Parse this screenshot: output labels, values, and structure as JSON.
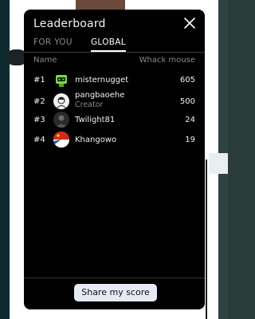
{
  "modal": {
    "title": "Leaderboard",
    "tabs": [
      {
        "label": "FOR YOU",
        "active": false
      },
      {
        "label": "GLOBAL",
        "active": true
      }
    ],
    "columns": {
      "name": "Name",
      "game": "Whack mouse"
    },
    "rows": [
      {
        "rank": "#1",
        "name": "misternugget",
        "subtitle": "",
        "score": "605",
        "avatar": "green-robot-avatar"
      },
      {
        "rank": "#2",
        "name": "pangbaoehe",
        "subtitle": "Creator",
        "score": "500",
        "avatar": "sketch-portrait-avatar"
      },
      {
        "rank": "#3",
        "name": "Twilight81",
        "subtitle": "",
        "score": "24",
        "avatar": "dark-photo-avatar"
      },
      {
        "rank": "#4",
        "name": "Khangowo",
        "subtitle": "",
        "score": "19",
        "avatar": "flag-avatar"
      }
    ],
    "share_label": "Share my score",
    "close_icon": "close-icon"
  },
  "colors": {
    "modal_bg": "#000000",
    "text": "#f2f2f2",
    "muted": "#8a8a8a",
    "button_bg": "#e6eaf6"
  }
}
